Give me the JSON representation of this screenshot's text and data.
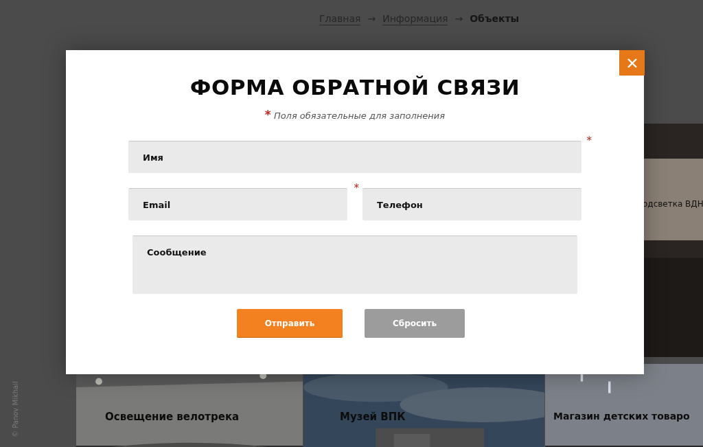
{
  "breadcrumb": [
    {
      "label": "Главная",
      "kind": "link"
    },
    {
      "label": "→",
      "kind": "separator"
    },
    {
      "label": "Информация",
      "kind": "link"
    },
    {
      "label": "→",
      "kind": "separator"
    },
    {
      "label": "Объекты",
      "kind": "current"
    }
  ],
  "side_credit": "© Panov Mikhail",
  "tiles": [
    {
      "caption": "одсветка ВДН",
      "kind": "small"
    },
    {
      "caption": "Освещение велотрека",
      "kind": "arena"
    },
    {
      "caption": "Музей ВПК",
      "kind": "sky"
    },
    {
      "caption": "Магазин детских товаро",
      "kind": "hall"
    }
  ],
  "dialog": {
    "title": "ФОРМА ОБРАТНОЙ СВЯЗИ",
    "note_mark": "*",
    "note": "Поля обязательные для заполнения",
    "fields": [
      {
        "placeholder": "Имя",
        "kind": "wide",
        "required_mark": "*"
      },
      {
        "placeholder": "Email",
        "kind": "half",
        "required_mark": "*"
      },
      {
        "placeholder": "Телефон",
        "kind": "half"
      },
      {
        "placeholder": "Сообщение",
        "kind": "textarea"
      }
    ],
    "buttons": [
      {
        "label": "Отправить",
        "kind": "primary"
      },
      {
        "label": "Сбросить",
        "kind": "secondary"
      }
    ]
  }
}
